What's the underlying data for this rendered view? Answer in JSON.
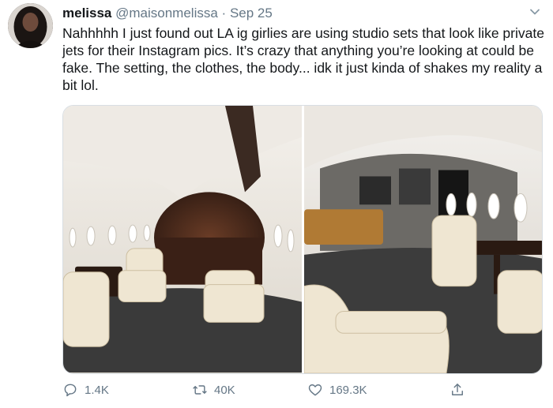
{
  "tweet": {
    "author_name": "melissa",
    "handle": "@maisonmelissa",
    "separator": "·",
    "date": "Sep 25",
    "text": "Nahhhhh I just found out LA ig girlies are using studio sets that look like private jets for their Instagram pics. It’s crazy that anything you’re looking at could be fake. The setting, the clothes, the body... idk it just kinda of shakes my reality a bit lol.",
    "avatar_icon": "avatar-photo",
    "menu_icon": "chevron-down-icon"
  },
  "media": {
    "photo_count": 2,
    "colors": {
      "cabin_wall": "#ece8e1",
      "carpet": "#3a3a3a",
      "wood": "#4a2a1c",
      "seat": "#efe6d2"
    }
  },
  "actions": {
    "reply_count": "1.4K",
    "retweet_count": "40K",
    "like_count": "169.3K",
    "reply_icon": "reply-icon",
    "retweet_icon": "retweet-icon",
    "like_icon": "heart-icon",
    "share_icon": "share-icon"
  },
  "colors": {
    "text": "#14171a",
    "muted": "#657786",
    "border": "#e6ecf0"
  }
}
